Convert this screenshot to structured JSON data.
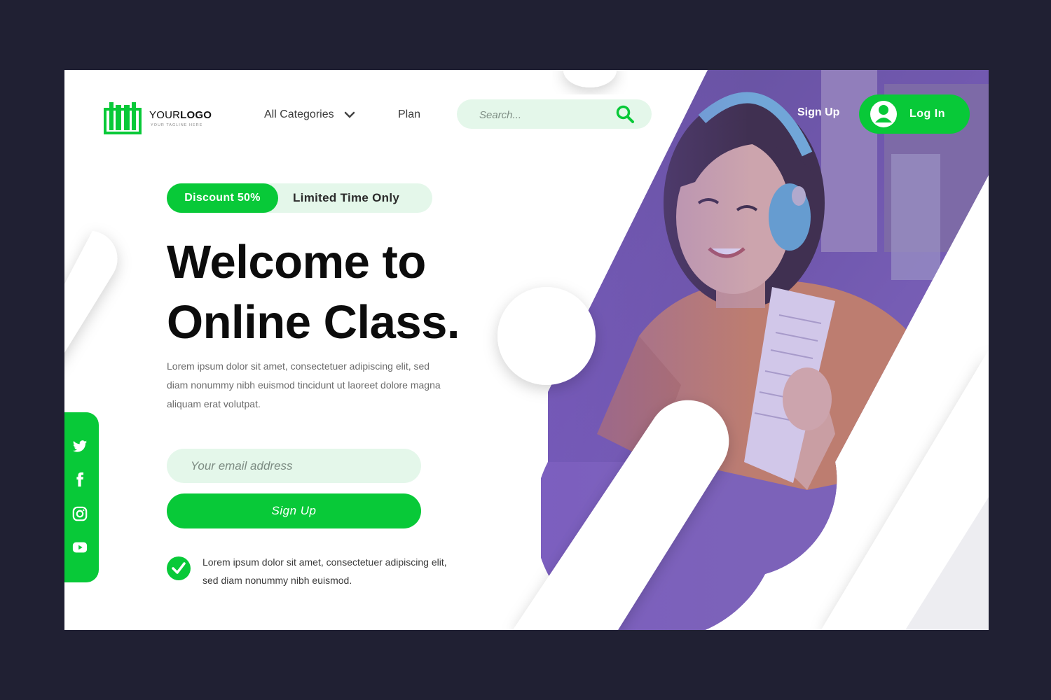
{
  "brand": {
    "logo_name_light": "YOUR",
    "logo_name_bold": "LOGO",
    "tagline": "YOUR TAGLINE HERE"
  },
  "nav": {
    "categories_label": "All Categories",
    "plan_label": "Plan",
    "search_placeholder": "Search...",
    "signup_label": "Sign Up",
    "login_label": "Log In"
  },
  "hero": {
    "promo_badge": "Discount 50%",
    "promo_text": "Limited Time Only",
    "headline_line1": "Welcome to",
    "headline_line2": "Online Class.",
    "description": "Lorem ipsum dolor sit amet, consectetuer adipiscing elit, sed diam nonummy nibh euismod tincidunt ut laoreet dolore magna aliquam erat volutpat.",
    "email_placeholder": "Your email address",
    "signup_button": "Sign Up",
    "check_text": "Lorem ipsum dolor sit amet, consectetuer adipiscing elit, sed diam nonummy nibh euismod."
  },
  "social": {
    "icons": [
      "twitter-icon",
      "facebook-icon",
      "instagram-icon",
      "youtube-icon"
    ]
  },
  "colors": {
    "accent": "#08c938",
    "accent_light": "#e4f7ea",
    "frame_bg": "#202033",
    "photo_tint": "#7b5cc4"
  }
}
